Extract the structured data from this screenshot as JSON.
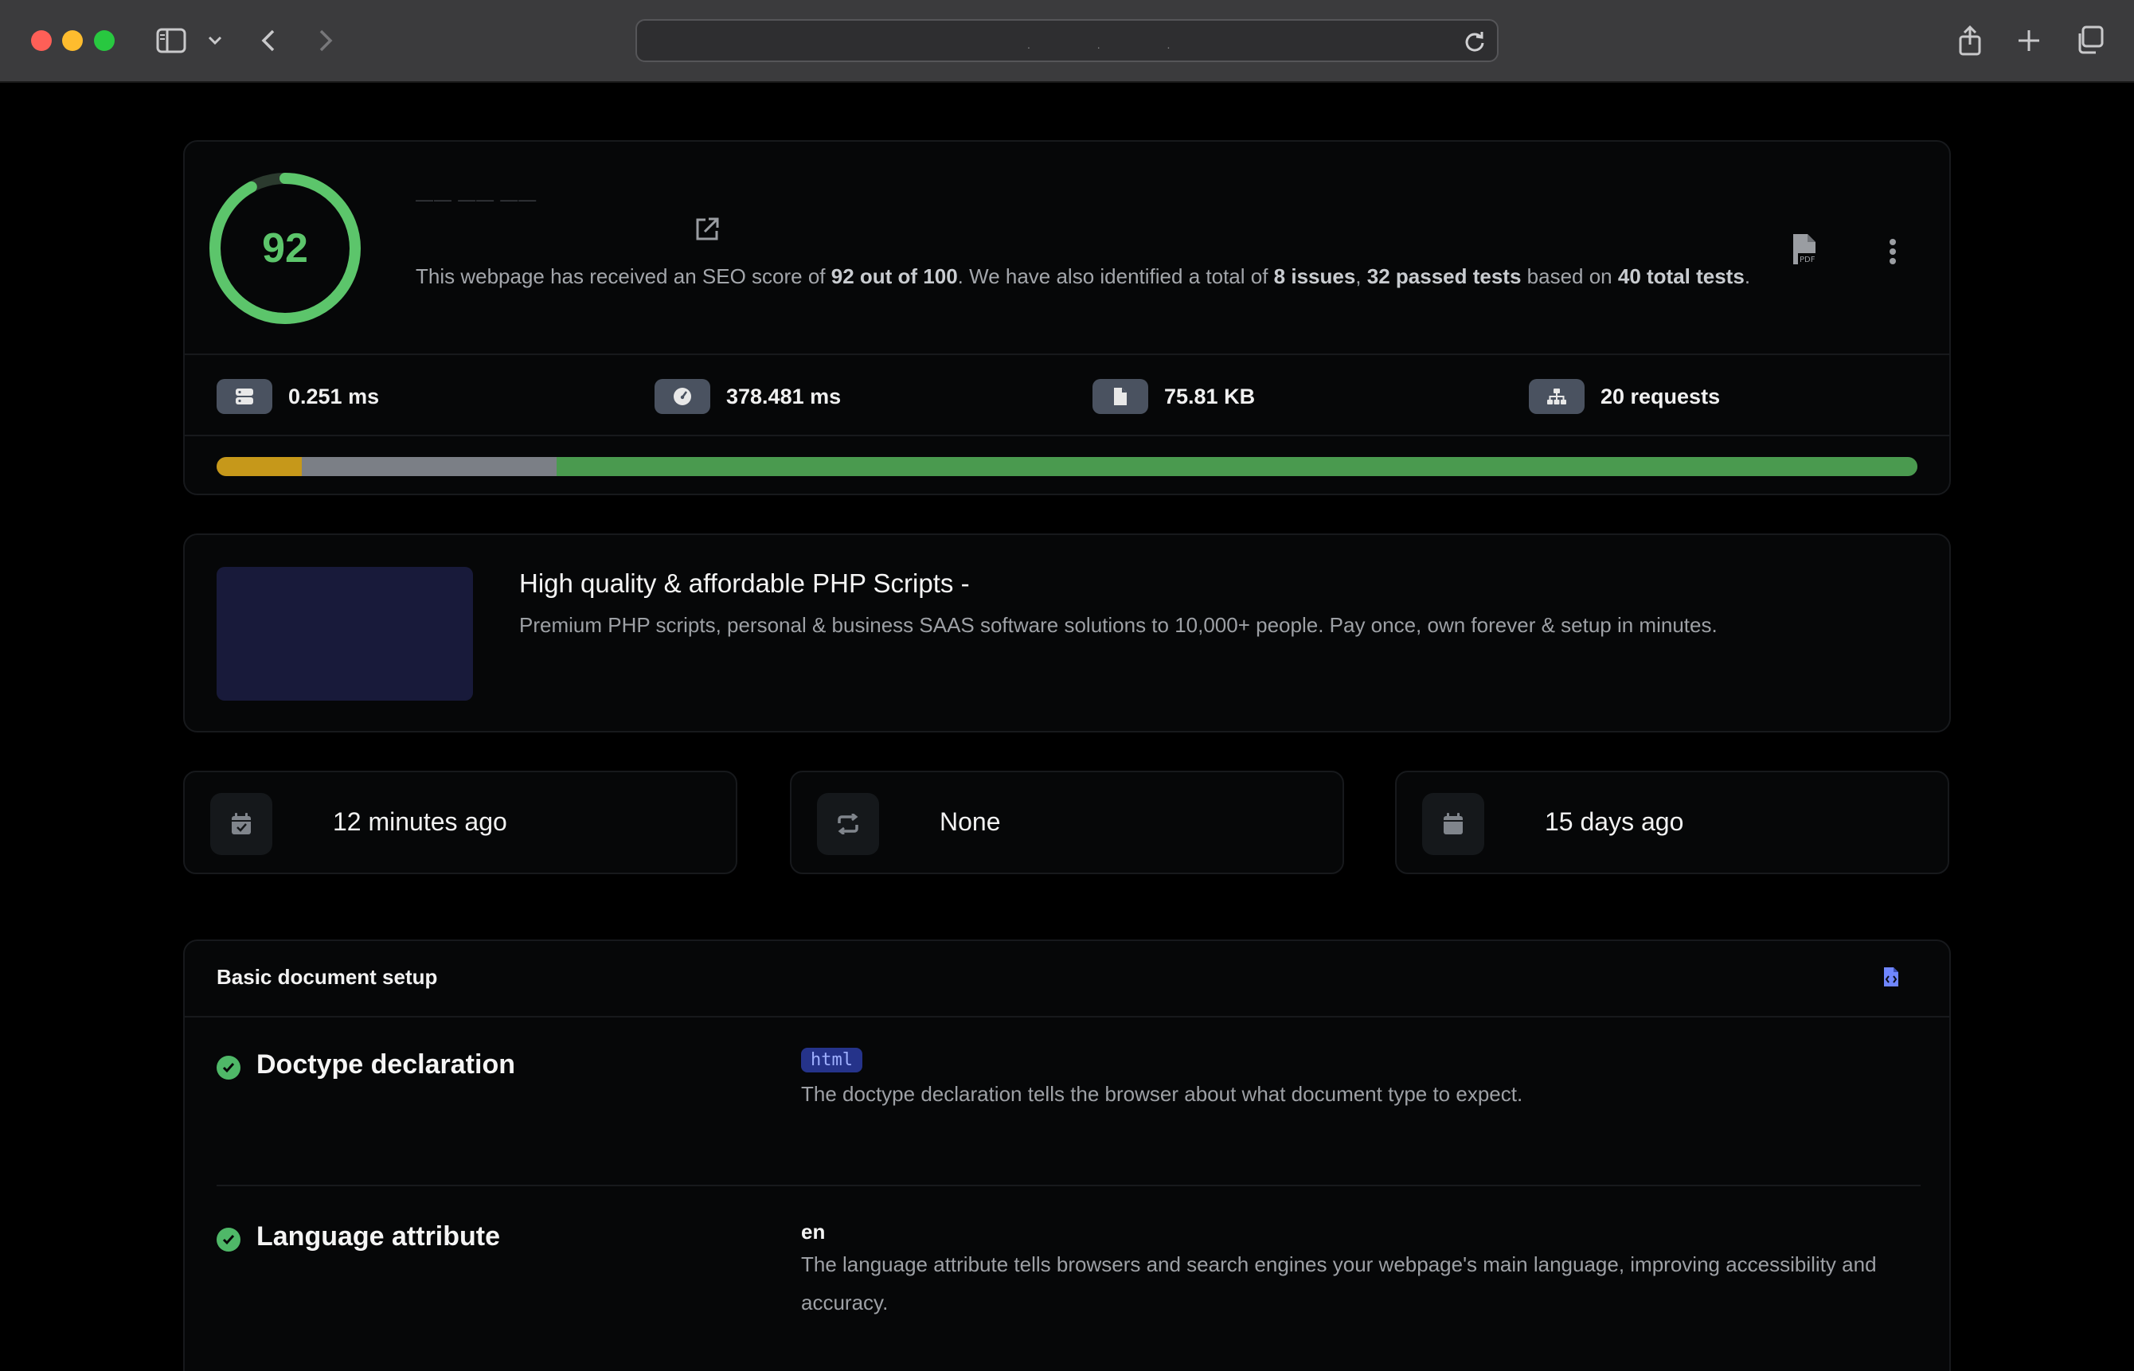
{
  "browser": {
    "address_dots": ". . ."
  },
  "score": {
    "value": "92",
    "percent": 92,
    "site_url": "—— —— ——",
    "summary_prefix": "This webpage has received an SEO score of ",
    "summary_score": "92 out of 100",
    "summary_mid1": ". We have also identified a total of ",
    "summary_issues": "8 issues",
    "summary_comma": ", ",
    "summary_passed": "32 passed tests",
    "summary_mid2": " based on ",
    "summary_total": "40 total tests",
    "summary_end": "."
  },
  "metrics": {
    "load_time": "0.251 ms",
    "render_time": "378.481 ms",
    "page_size": "75.81 KB",
    "requests": "20 requests"
  },
  "progress": {
    "segments": [
      {
        "name": "warning",
        "fraction": 0.05,
        "color": "#c6981a"
      },
      {
        "name": "neutral",
        "fraction": 0.15,
        "color": "#7b7f86"
      },
      {
        "name": "passed",
        "fraction": 0.8,
        "color": "#4a9a4f"
      }
    ]
  },
  "meta": {
    "title": "High quality & affordable PHP Scripts -",
    "description": "Premium PHP scripts, personal & business SAAS software solutions to 10,000+ people. Pay once, own forever & setup in minutes."
  },
  "stats": {
    "generated": "12 minutes ago",
    "redirect": "None",
    "domain_age": "15 days ago"
  },
  "section": {
    "title": "Basic document setup",
    "rows": [
      {
        "label": "Doctype declaration",
        "value": "html",
        "description": "The doctype declaration tells the browser about what document type to expect."
      },
      {
        "label": "Language attribute",
        "value": "en",
        "description": "The language attribute tells browsers and search engines your webpage's main language, improving accessibility and accuracy."
      }
    ]
  },
  "colors": {
    "score_green": "#5cc56b",
    "check_green": "#4fb868",
    "code_badge_bg": "#25338a"
  }
}
